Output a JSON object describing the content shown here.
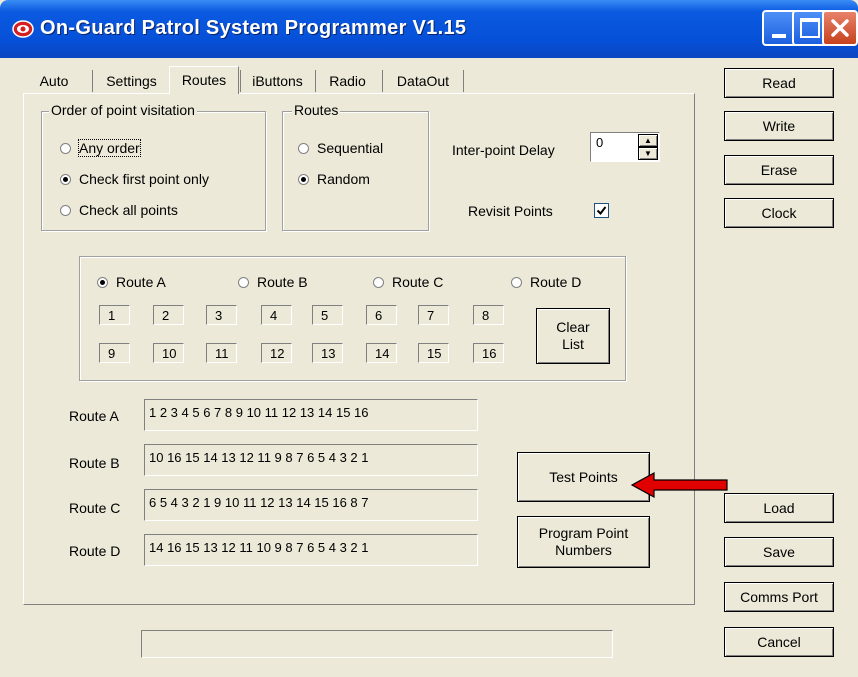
{
  "window": {
    "title": "On-Guard Patrol System Programmer V1.15"
  },
  "tabs": [
    {
      "label": "Auto"
    },
    {
      "label": "Settings"
    },
    {
      "label": "Routes"
    },
    {
      "label": "iButtons"
    },
    {
      "label": "Radio"
    },
    {
      "label": "DataOut"
    }
  ],
  "order_group": {
    "title": "Order of point visitation",
    "options": [
      {
        "label": "Any order",
        "selected": false
      },
      {
        "label": "Check first point only",
        "selected": true
      },
      {
        "label": "Check all points",
        "selected": false
      }
    ]
  },
  "routes_group": {
    "title": "Routes",
    "options": [
      {
        "label": "Sequential",
        "selected": false
      },
      {
        "label": "Random",
        "selected": true
      }
    ]
  },
  "delay": {
    "label": "Inter-point Delay",
    "value": "0"
  },
  "revisit": {
    "label": "Revisit Points",
    "checked": true
  },
  "route_select": [
    {
      "label": "Route A",
      "selected": true
    },
    {
      "label": "Route B",
      "selected": false
    },
    {
      "label": "Route C",
      "selected": false
    },
    {
      "label": "Route D",
      "selected": false
    }
  ],
  "points_row1": [
    "1",
    "2",
    "3",
    "4",
    "5",
    "6",
    "7",
    "8"
  ],
  "points_row2": [
    "9",
    "10",
    "11",
    "12",
    "13",
    "14",
    "15",
    "16"
  ],
  "clear_list": {
    "line1": "Clear",
    "line2": "List"
  },
  "routes": [
    {
      "label": "Route A",
      "value": "1 2 3 4 5 6 7 8 9 10 11 12 13 14 15 16"
    },
    {
      "label": "Route B",
      "value": "10 16 15 14 13 12 11 9 8 7 6 5 4 3 2 1"
    },
    {
      "label": "Route C",
      "value": "6 5 4 3 2 1 9 10 11 12 13 14 15 16 8 7"
    },
    {
      "label": "Route D",
      "value": "14 16 15 13 12 11 10 9 8 7 6 5 4 3 2 1"
    }
  ],
  "test_points": {
    "label": "Test Points"
  },
  "program_points": {
    "line1": "Program Point",
    "line2": "Numbers"
  },
  "side_buttons": {
    "read": "Read",
    "write": "Write",
    "erase": "Erase",
    "clock": "Clock",
    "load": "Load",
    "save": "Save",
    "comms_port": "Comms Port",
    "cancel": "Cancel"
  },
  "colors": {
    "arrow": "#e00000",
    "titlebar": "#0650d8"
  }
}
